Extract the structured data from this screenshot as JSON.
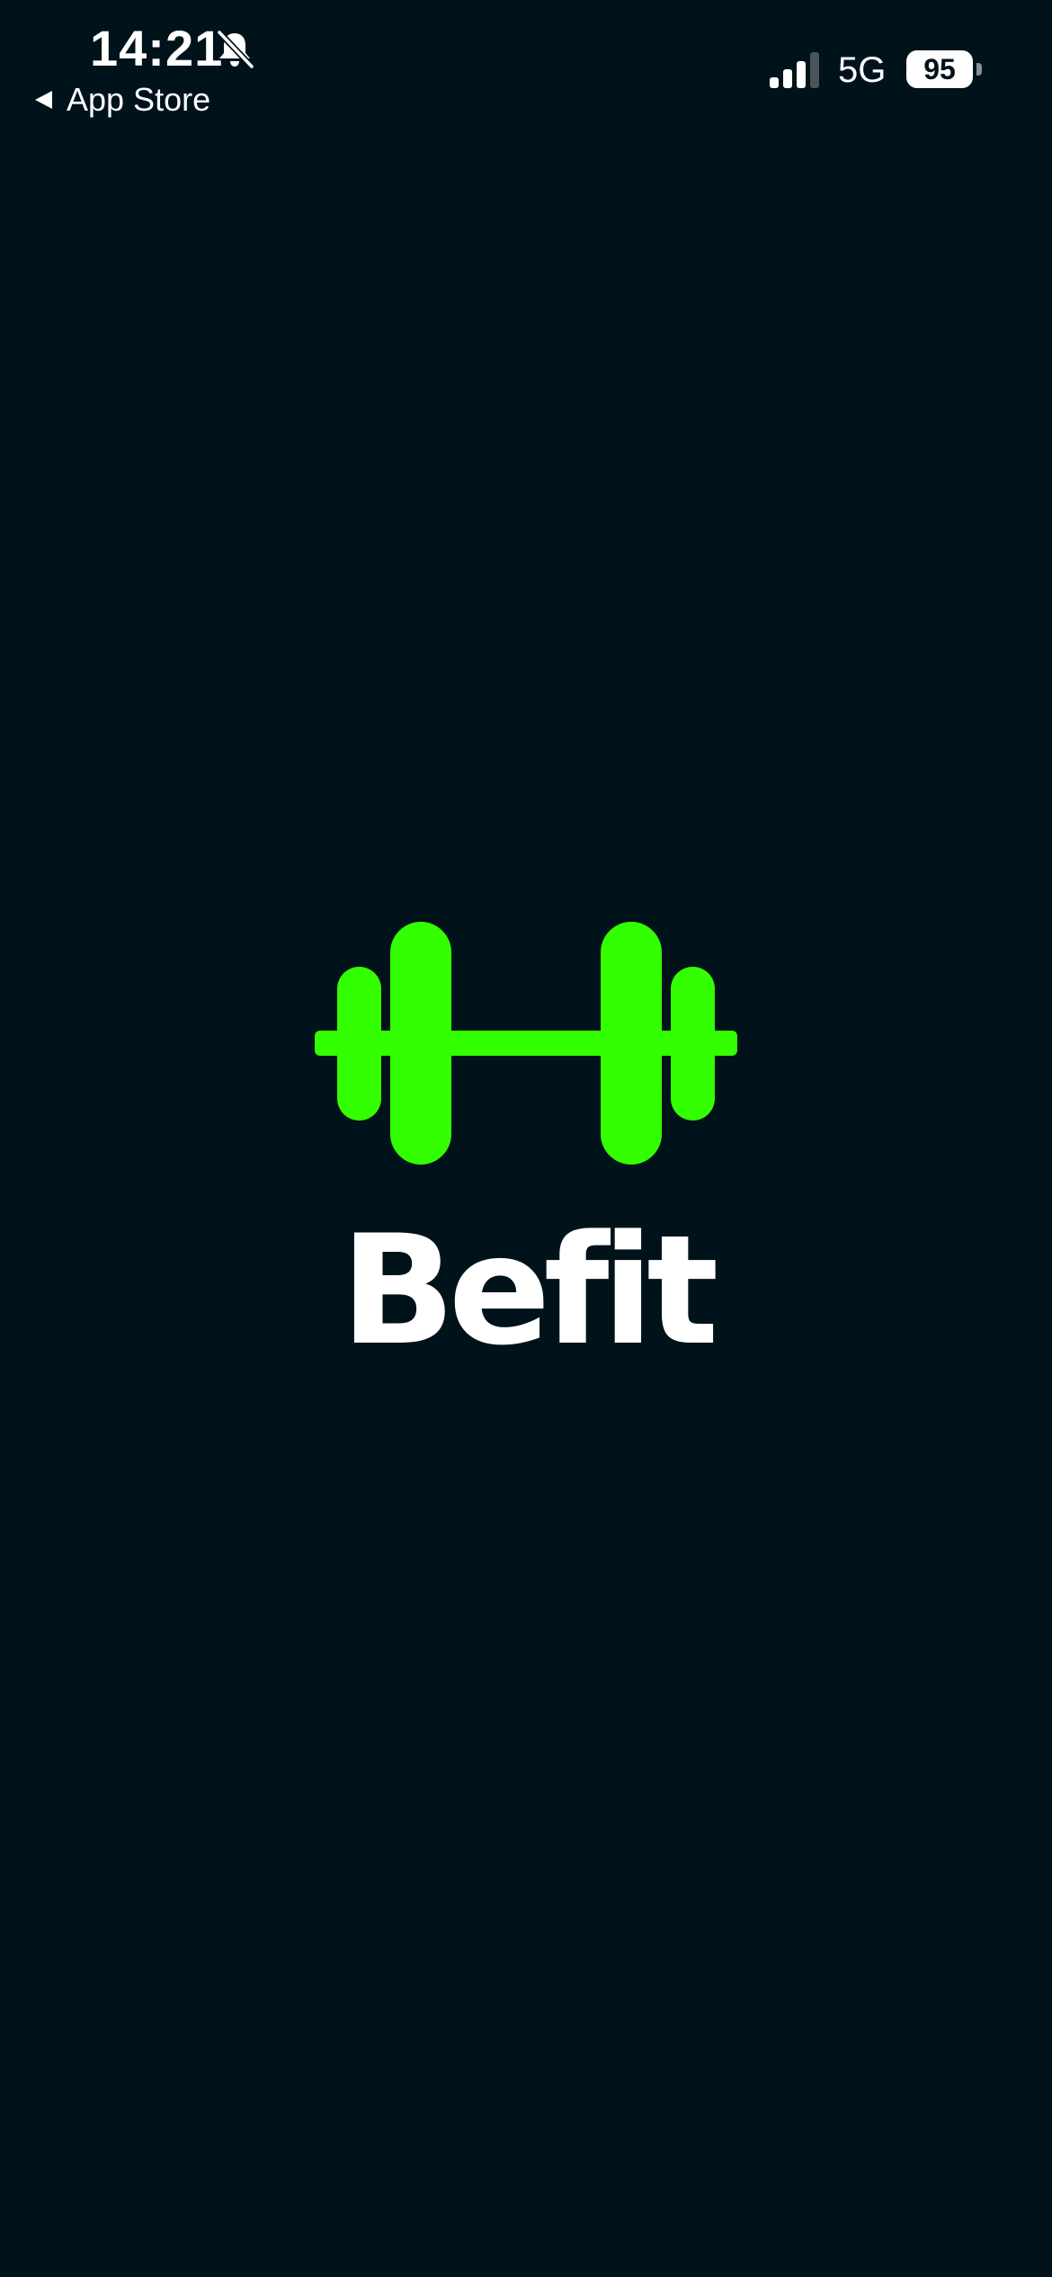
{
  "status_bar": {
    "time": "14:21",
    "back_label": "App Store",
    "network": "5G",
    "battery_level": "95",
    "icons": {
      "silent": "bell-slash-icon",
      "back": "back-triangle-icon",
      "signal": "cellular-signal-icon",
      "battery": "battery-icon"
    }
  },
  "splash": {
    "app_name": "Befit",
    "logo": "dumbbell-icon"
  },
  "colors": {
    "background": "#00121A",
    "accent": "#33FF00",
    "text": "#FFFFFF"
  }
}
